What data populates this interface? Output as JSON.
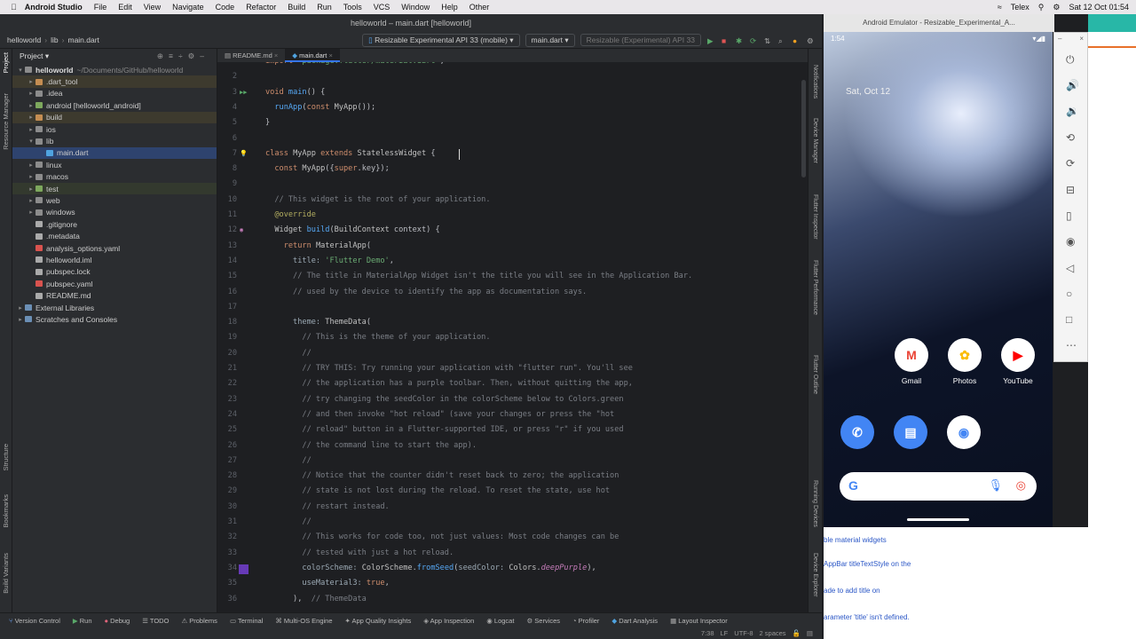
{
  "menubar": {
    "app": "Android Studio",
    "items": [
      "File",
      "Edit",
      "View",
      "Navigate",
      "Code",
      "Refactor",
      "Build",
      "Run",
      "Tools",
      "VCS",
      "Window",
      "Help",
      "Other"
    ],
    "telex": "Telex",
    "date": "Sat 12 Oct 01:54"
  },
  "window": {
    "title": "helloworld – main.dart [helloworld]"
  },
  "breadcrumb": {
    "project": "helloworld",
    "folder": "lib",
    "file": "main.dart"
  },
  "toolbar": {
    "device": "Resizable Experimental API 33 (mobile)",
    "config": "main.dart",
    "device2": "Resizable (Experimental) API 33"
  },
  "project": {
    "title": "Project",
    "root": "helloworld",
    "root_path": "~/Documents/GitHub/helloworld",
    "items": [
      {
        "label": ".dart_tool",
        "depth": 1,
        "arrow": "▸",
        "color": "#c48d52",
        "style": "ex"
      },
      {
        "label": ".idea",
        "depth": 1,
        "arrow": "▸",
        "color": "#8c8c8c",
        "style": ""
      },
      {
        "label": "android [helloworld_android]",
        "depth": 1,
        "arrow": "▸",
        "color": "#7da85d",
        "style": ""
      },
      {
        "label": "build",
        "depth": 1,
        "arrow": "▸",
        "color": "#c48d52",
        "style": "ex"
      },
      {
        "label": "ios",
        "depth": 1,
        "arrow": "▸",
        "color": "#8c8c8c",
        "style": ""
      },
      {
        "label": "lib",
        "depth": 1,
        "arrow": "▾",
        "color": "#8c8c8c",
        "style": ""
      },
      {
        "label": "main.dart",
        "depth": 2,
        "arrow": "",
        "color": "#4fa3e0",
        "style": "sel"
      },
      {
        "label": "linux",
        "depth": 1,
        "arrow": "▸",
        "color": "#8c8c8c",
        "style": ""
      },
      {
        "label": "macos",
        "depth": 1,
        "arrow": "▸",
        "color": "#8c8c8c",
        "style": ""
      },
      {
        "label": "test",
        "depth": 1,
        "arrow": "▸",
        "color": "#7da85d",
        "style": "test"
      },
      {
        "label": "web",
        "depth": 1,
        "arrow": "▸",
        "color": "#8c8c8c",
        "style": ""
      },
      {
        "label": "windows",
        "depth": 1,
        "arrow": "▸",
        "color": "#8c8c8c",
        "style": ""
      },
      {
        "label": ".gitignore",
        "depth": 1,
        "arrow": "",
        "color": "#aaaaaa",
        "style": ""
      },
      {
        "label": ".metadata",
        "depth": 1,
        "arrow": "",
        "color": "#aaaaaa",
        "style": ""
      },
      {
        "label": "analysis_options.yaml",
        "depth": 1,
        "arrow": "",
        "color": "#d9534f",
        "style": ""
      },
      {
        "label": "helloworld.iml",
        "depth": 1,
        "arrow": "",
        "color": "#aaaaaa",
        "style": ""
      },
      {
        "label": "pubspec.lock",
        "depth": 1,
        "arrow": "",
        "color": "#aaaaaa",
        "style": ""
      },
      {
        "label": "pubspec.yaml",
        "depth": 1,
        "arrow": "",
        "color": "#d9534f",
        "style": ""
      },
      {
        "label": "README.md",
        "depth": 1,
        "arrow": "",
        "color": "#aaaaaa",
        "style": ""
      },
      {
        "label": "External Libraries",
        "depth": 0,
        "arrow": "▸",
        "color": "#6b8fb5",
        "style": ""
      },
      {
        "label": "Scratches and Consoles",
        "depth": 0,
        "arrow": "▸",
        "color": "#6b8fb5",
        "style": ""
      }
    ]
  },
  "tabs": [
    {
      "label": "README.md"
    },
    {
      "label": "main.dart"
    }
  ],
  "left_tools": [
    "Project",
    "Resource Manager",
    "Structure",
    "Bookmarks",
    "Build Variants"
  ],
  "right_tools": [
    "Notifications",
    "Device Manager",
    "Flutter Inspector",
    "Flutter Performance",
    "Flutter Outline",
    "Running Devices",
    "Device Explorer"
  ],
  "code_lines": [
    {
      "n": "",
      "html": "<span class='kw'>import</span> <span class='str'>'package:flutter/material.dart'</span>;"
    },
    {
      "n": "2",
      "html": ""
    },
    {
      "n": "3",
      "html": "<span class='kw'>void</span> <span class='fn'>main</span>() {"
    },
    {
      "n": "4",
      "html": "  <span class='fn'>runApp</span>(<span class='kw'>const</span> <span class='ty'>MyApp</span>());"
    },
    {
      "n": "5",
      "html": "}"
    },
    {
      "n": "6",
      "html": ""
    },
    {
      "n": "7",
      "html": "<span class='kw'>class</span> <span class='ty'>MyApp</span> <span class='kw'>extends</span> <span class='ty'>StatelessWidget</span> {"
    },
    {
      "n": "8",
      "html": "  <span class='kw'>const</span> <span class='ty'>MyApp</span>({<span class='kw'>super</span>.key});"
    },
    {
      "n": "9",
      "html": ""
    },
    {
      "n": "10",
      "html": "  <span class='cm'>// This widget is the root of your application.</span>"
    },
    {
      "n": "11",
      "html": "  <span class='ann'>@override</span>"
    },
    {
      "n": "12",
      "html": "  <span class='ty'>Widget</span> <span class='fn'>build</span>(<span class='ty'>BuildContext</span> context) {"
    },
    {
      "n": "13",
      "html": "    <span class='kw'>return</span> <span class='ty'>MaterialApp</span>("
    },
    {
      "n": "14",
      "html": "      <span class='param'>title:</span> <span class='str'>'Flutter Demo'</span>,"
    },
    {
      "n": "15",
      "html": "      <span class='cm'>// The title in MaterialApp Widget isn't the title you will see in the Application Bar.</span>"
    },
    {
      "n": "16",
      "html": "      <span class='cm'>// used by the device to identify the app as documentation says.</span>"
    },
    {
      "n": "17",
      "html": ""
    },
    {
      "n": "18",
      "html": "      <span class='param'>theme:</span> <span class='ty'>ThemeData</span>("
    },
    {
      "n": "19",
      "html": "        <span class='cm'>// This is the theme of your application.</span>"
    },
    {
      "n": "20",
      "html": "        <span class='cm'>//</span>"
    },
    {
      "n": "21",
      "html": "        <span class='cm'>// TRY THIS: Try running your application with \"flutter run\". You'll see</span>"
    },
    {
      "n": "22",
      "html": "        <span class='cm'>// the application has a purple toolbar. Then, without quitting the app,</span>"
    },
    {
      "n": "23",
      "html": "        <span class='cm'>// try changing the seedColor in the colorScheme below to Colors.green</span>"
    },
    {
      "n": "24",
      "html": "        <span class='cm'>// and then invoke \"hot reload\" (save your changes or press the \"hot</span>"
    },
    {
      "n": "25",
      "html": "        <span class='cm'>// reload\" button in a Flutter-supported IDE, or press \"r\" if you used</span>"
    },
    {
      "n": "26",
      "html": "        <span class='cm'>// the command line to start the app).</span>"
    },
    {
      "n": "27",
      "html": "        <span class='cm'>//</span>"
    },
    {
      "n": "28",
      "html": "        <span class='cm'>// Notice that the counter didn't reset back to zero; the application</span>"
    },
    {
      "n": "29",
      "html": "        <span class='cm'>// state is not lost during the reload. To reset the state, use hot</span>"
    },
    {
      "n": "30",
      "html": "        <span class='cm'>// restart instead.</span>"
    },
    {
      "n": "31",
      "html": "        <span class='cm'>//</span>"
    },
    {
      "n": "32",
      "html": "        <span class='cm'>// This works for code too, not just values: Most code changes can be</span>"
    },
    {
      "n": "33",
      "html": "        <span class='cm'>// tested with just a hot reload.</span>"
    },
    {
      "n": "34",
      "html": "        <span class='param'>colorScheme:</span> <span class='ty'>ColorScheme</span>.<span class='fn'>fromSeed</span>(<span class='param'>seedColor:</span> <span class='ty'>Colors</span>.<span class='it'>deepPurple</span>),"
    },
    {
      "n": "35",
      "html": "        <span class='param'>useMaterial3:</span> <span class='kw'>true</span>,"
    },
    {
      "n": "36",
      "html": "      ),  <span class='cm'>// ThemeData</span>"
    }
  ],
  "bottom_tools": [
    "Version Control",
    "Run",
    "Debug",
    "TODO",
    "Problems",
    "Terminal",
    "Multi-OS Engine",
    "App Quality Insights",
    "App Inspection",
    "Logcat",
    "Services",
    "Profiler",
    "Dart Analysis",
    "Layout Inspector"
  ],
  "status": {
    "pos": "7:38",
    "lf": "LF",
    "enc": "UTF-8",
    "indent": "2 spaces"
  },
  "emulator": {
    "title": "Android Emulator - Resizable_Experimental_A...",
    "time": "1:54",
    "date": "Sat, Oct 12",
    "apps": [
      {
        "label": "Gmail",
        "glyph": "M",
        "color": "#ea4335"
      },
      {
        "label": "Photos",
        "glyph": "✿",
        "color": "#fbbc04"
      },
      {
        "label": "YouTube",
        "glyph": "▶",
        "color": "#ff0000"
      }
    ],
    "dock": [
      {
        "glyph": "✆",
        "bg": "#4285f4"
      },
      {
        "glyph": "▤",
        "bg": "#4285f4"
      },
      {
        "glyph": "◉",
        "bg": "#ffffff"
      }
    ],
    "search_g": "G"
  },
  "bg_snippets": [
    "ble material widgets",
    "AppBar titleTextStyle on the",
    "ade to add title on",
    "arameter 'title' isn't defined."
  ]
}
